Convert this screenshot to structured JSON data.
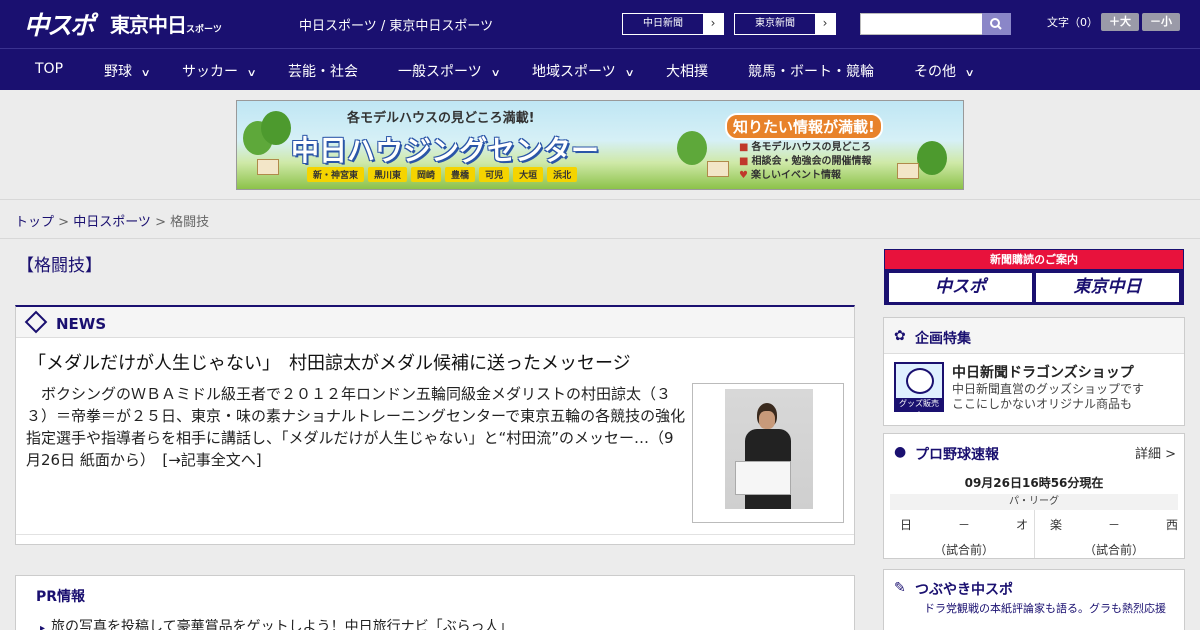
{
  "header": {
    "logo_chuspo": "中スポ",
    "logo_tokyo": "東京中日",
    "logo_tokyo_small": "スポーツ",
    "sites_link": "中日スポーツ / 東京中日スポーツ",
    "paper_buttons": [
      "中日新聞",
      "東京新聞"
    ],
    "search": {
      "value": "",
      "placeholder": ""
    },
    "font_size_label": "文字（0）",
    "font_bigger": "＋大",
    "font_smaller": "－小"
  },
  "nav": {
    "items": [
      {
        "label": "TOP",
        "has_menu": false
      },
      {
        "label": "野球",
        "has_menu": true
      },
      {
        "label": "サッカー",
        "has_menu": true
      },
      {
        "label": "芸能・社会",
        "has_menu": false
      },
      {
        "label": "一般スポーツ",
        "has_menu": true
      },
      {
        "label": "地域スポーツ",
        "has_menu": true
      },
      {
        "label": "大相撲",
        "has_menu": false
      },
      {
        "label": "競馬・ボート・競輪",
        "has_menu": false
      },
      {
        "label": "その他",
        "has_menu": true
      }
    ]
  },
  "banner": {
    "top_text": "各モデルハウスの見どころ満載!",
    "main_text": "中日ハウジングセンター",
    "areas": [
      "新・神宮東",
      "黒川東",
      "岡崎",
      "豊橋",
      "可児",
      "大垣",
      "浜北"
    ],
    "right_headline": "知りたい情報が満載!",
    "right_items": [
      "各モデルハウスの見どころ",
      "相談会・勉強会の開催情報",
      "楽しいイベント情報"
    ]
  },
  "breadcrumb": {
    "home": "トップ",
    "section": "中日スポーツ",
    "current": "格闘技",
    "sep": " > "
  },
  "page_title": "【格闘技】",
  "news": {
    "label": "NEWS",
    "headline": "「メダルだけが人生じゃない」　村田諒太がメダル候補に送ったメッセージ",
    "body": "　ボクシングのＷＢＡミドル級王者で２０１２年ロンドン五輪同級金メダリストの村田諒太（３３）＝帝拳＝が２５日、東京・味の素ナショナルトレーニングセンターで東京五輪の各競技の強化指定選手や指導者らを相手に講話し、「メダルだけが人生じゃない」と“村田流”のメッセー…（9月26日 紙面から）　[→記事全文へ]"
  },
  "pr": {
    "heading": "PR情報",
    "items": [
      "旅の写真を投稿して豪華賞品をゲットしよう！中日旅行ナビ「ぶらっ人」"
    ]
  },
  "subscribe": {
    "heading": "新聞購読のご案内",
    "logos": [
      "中スポ",
      "東京中日"
    ]
  },
  "feature": {
    "title": "企画特集",
    "logo_label": "グッズ販売中",
    "name": "中日新聞ドラゴンズショップ",
    "desc1": "中日新聞直営のグッズショップです",
    "desc2": "ここにしかないオリジナル商品も"
  },
  "baseball": {
    "title": "プロ野球速報",
    "more": "詳細 >",
    "date": "09月26日16時56分現在",
    "league": "パ・リーグ",
    "games": [
      {
        "home": "日",
        "sep": "－",
        "away": "オ",
        "state": "（試合前）"
      },
      {
        "home": "楽",
        "sep": "－",
        "away": "西",
        "state": "（試合前）"
      }
    ]
  },
  "tweet": {
    "title": "つぶやき中スポ",
    "sub": "ドラ党観戦の本紙評論家も語る。グラも熱烈応援"
  },
  "colors": {
    "brand_navy": "#1a1070",
    "subscribe_red": "#e8123c",
    "banner_yellow": "#f5d400"
  },
  "icons": [
    "search-icon",
    "chevron-right-icon",
    "chevron-down-icon",
    "news-icon",
    "feature-ribbon-icon",
    "baseball-icon",
    "tweet-icon"
  ]
}
